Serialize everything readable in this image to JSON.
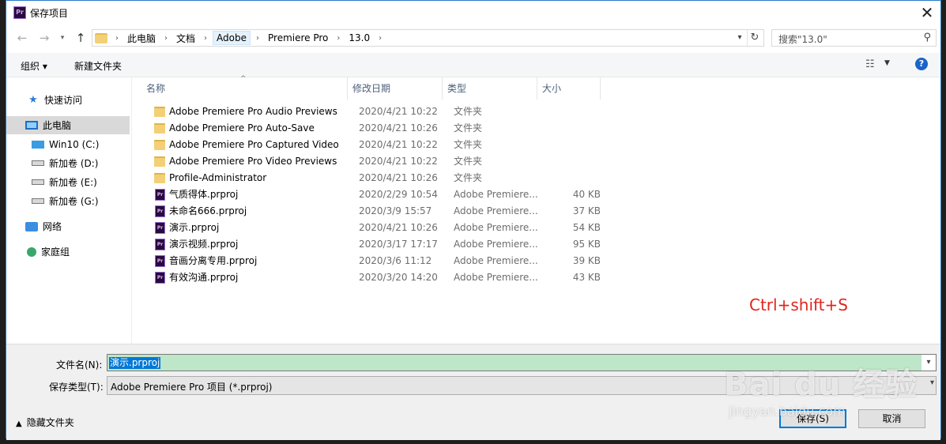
{
  "window": {
    "title": "保存项目",
    "app_icon": "Pr"
  },
  "nav": {
    "crumbs": [
      "此电脑",
      "文档",
      "Adobe",
      "Premiere Pro",
      "13.0"
    ],
    "search_placeholder": "搜索\"13.0\""
  },
  "toolbar": {
    "organize": "组织 ▾",
    "new_folder": "新建文件夹",
    "help": "?"
  },
  "sidebar": {
    "items": [
      {
        "label": "快速访问",
        "icon": "star-icon"
      },
      {
        "label": "此电脑",
        "icon": "computer-icon",
        "selected": true
      },
      {
        "label": "Win10 (C:)",
        "icon": "windows-drive-icon"
      },
      {
        "label": "新加卷 (D:)",
        "icon": "drive-icon"
      },
      {
        "label": "新加卷 (E:)",
        "icon": "drive-icon"
      },
      {
        "label": "新加卷 (G:)",
        "icon": "drive-icon"
      },
      {
        "label": "网络",
        "icon": "network-icon"
      },
      {
        "label": "家庭组",
        "icon": "homegroup-icon"
      }
    ]
  },
  "columns": {
    "name": "名称",
    "date": "修改日期",
    "type": "类型",
    "size": "大小"
  },
  "files": [
    {
      "name": "Adobe Premiere Pro Audio Previews",
      "date": "2020/4/21 10:22",
      "type": "文件夹",
      "size": "",
      "kind": "folder"
    },
    {
      "name": "Adobe Premiere Pro Auto-Save",
      "date": "2020/4/21 10:26",
      "type": "文件夹",
      "size": "",
      "kind": "folder"
    },
    {
      "name": "Adobe Premiere Pro Captured Video",
      "date": "2020/4/21 10:22",
      "type": "文件夹",
      "size": "",
      "kind": "folder"
    },
    {
      "name": "Adobe Premiere Pro Video Previews",
      "date": "2020/4/21 10:22",
      "type": "文件夹",
      "size": "",
      "kind": "folder"
    },
    {
      "name": "Profile-Administrator",
      "date": "2020/4/21 10:26",
      "type": "文件夹",
      "size": "",
      "kind": "folder"
    },
    {
      "name": "气质得体.prproj",
      "date": "2020/2/29 10:54",
      "type": "Adobe Premiere...",
      "size": "40 KB",
      "kind": "prproj"
    },
    {
      "name": "未命名666.prproj",
      "date": "2020/3/9 15:57",
      "type": "Adobe Premiere...",
      "size": "37 KB",
      "kind": "prproj"
    },
    {
      "name": "演示.prproj",
      "date": "2020/4/21 10:26",
      "type": "Adobe Premiere...",
      "size": "54 KB",
      "kind": "prproj"
    },
    {
      "name": "演示视频.prproj",
      "date": "2020/3/17 17:17",
      "type": "Adobe Premiere...",
      "size": "95 KB",
      "kind": "prproj"
    },
    {
      "name": "音画分离专用.prproj",
      "date": "2020/3/6 11:12",
      "type": "Adobe Premiere...",
      "size": "39 KB",
      "kind": "prproj"
    },
    {
      "name": "有效沟通.prproj",
      "date": "2020/3/20 14:20",
      "type": "Adobe Premiere...",
      "size": "43 KB",
      "kind": "prproj"
    }
  ],
  "annotation": "Ctrl+shift+S",
  "form": {
    "filename_label": "文件名(N):",
    "filename_value": "演示.prproj",
    "filetype_label": "保存类型(T):",
    "filetype_value": "Adobe Premiere Pro 项目 (*.prproj)",
    "hide_folders": "隐藏文件夹",
    "save": "保存(S)",
    "cancel": "取消"
  },
  "watermark": {
    "big": "Bai du 经验",
    "small": "jingyan.baidu.com"
  }
}
